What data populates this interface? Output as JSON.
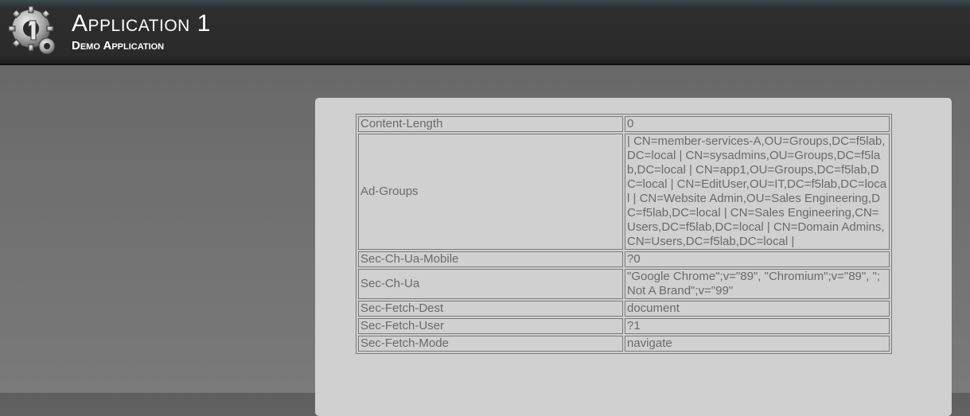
{
  "header": {
    "title": "Application 1",
    "subtitle": "Demo Application",
    "logo_icon": "gear-logo-icon"
  },
  "headers_table": {
    "rows": [
      {
        "name": "Content-Length",
        "value": "0"
      },
      {
        "name": "Ad-Groups",
        "value": "| CN=member-services-A,OU=Groups,DC=f5lab,DC=local | CN=sysadmins,OU=Groups,DC=f5lab,DC=local | CN=app1,OU=Groups,DC=f5lab,DC=local | CN=EditUser,OU=IT,DC=f5lab,DC=local | CN=Website Admin,OU=Sales Engineering,DC=f5lab,DC=local | CN=Sales Engineering,CN=Users,DC=f5lab,DC=local | CN=Domain Admins,CN=Users,DC=f5lab,DC=local |"
      },
      {
        "name": "Sec-Ch-Ua-Mobile",
        "value": "?0"
      },
      {
        "name": "Sec-Ch-Ua",
        "value": "\"Google Chrome\";v=\"89\", \"Chromium\";v=\"89\", \";Not A Brand\";v=\"99\""
      },
      {
        "name": "Sec-Fetch-Dest",
        "value": "document"
      },
      {
        "name": "Sec-Fetch-User",
        "value": "?1"
      },
      {
        "name": "Sec-Fetch-Mode",
        "value": "navigate"
      }
    ]
  },
  "colors": {
    "header_bg": "#2a2a2a",
    "page_bg": "#6b6b6b",
    "panel_bg": "#d0d0d0",
    "text": "#6a6a6a"
  }
}
